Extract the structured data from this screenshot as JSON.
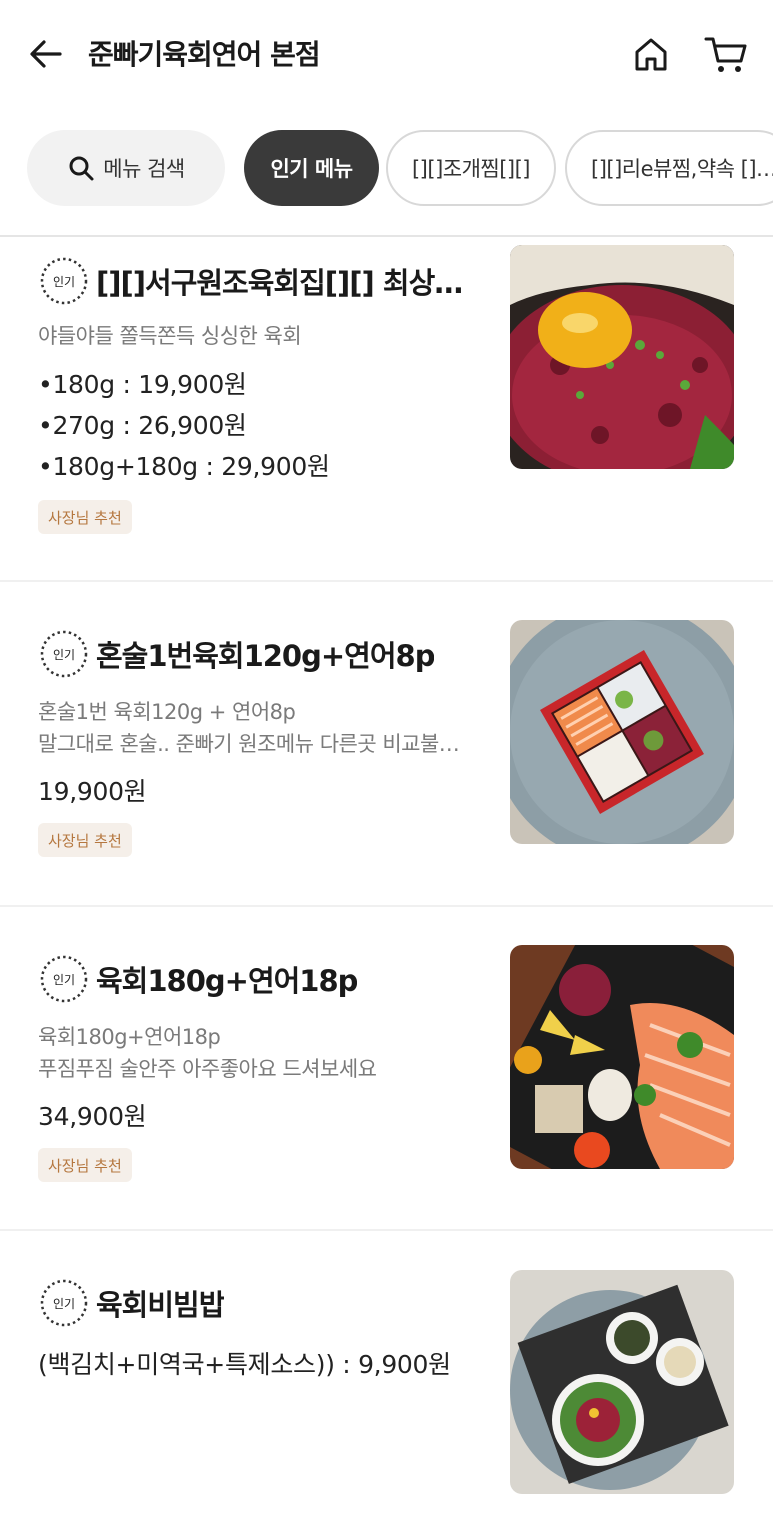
{
  "header": {
    "title": "준빠기육회연어 본점"
  },
  "categories": {
    "search_label": "메뉴 검색",
    "tabs": [
      {
        "label": "인기 메뉴",
        "active": true
      },
      {
        "label": "[][]조개찜[][]",
        "active": false
      },
      {
        "label": "[][]리e뷰찜,약속 []…",
        "active": false
      }
    ]
  },
  "badge_label": "인기",
  "tag_label": "사장님 추천",
  "menu_items": [
    {
      "name": "[][]서구원조육회집[][] 최상급…",
      "description": [
        "야들야들 쫄득쫀득 싱싱한 육회"
      ],
      "prices": [
        "•180g : 19,900원",
        "•270g : 26,900원",
        "•180g+180g : 29,900원"
      ],
      "tag": "사장님 추천"
    },
    {
      "name": "혼술1번육회120g+연어8p",
      "description": [
        "혼술1번 육회120g + 연어8p",
        "말그대로 혼술.. 준빠기 원조메뉴 다른곳 비교불…"
      ],
      "prices": [
        "19,900원"
      ],
      "tag": "사장님 추천"
    },
    {
      "name": "육회180g+연어18p",
      "description": [
        "육회180g+연어18p",
        "푸짐푸짐 술안주 아주좋아요 드셔보세요"
      ],
      "prices": [
        "34,900원"
      ],
      "tag": "사장님 추천"
    },
    {
      "name": "육회비빔밥",
      "description": [],
      "prices": [
        "(백김치+미역국+특제소스)) : 9,900원"
      ],
      "tag": ""
    }
  ],
  "colors": {
    "active_chip": "#3a3a3a",
    "tag_bg": "#f5efe9",
    "tag_text": "#b5773f"
  }
}
